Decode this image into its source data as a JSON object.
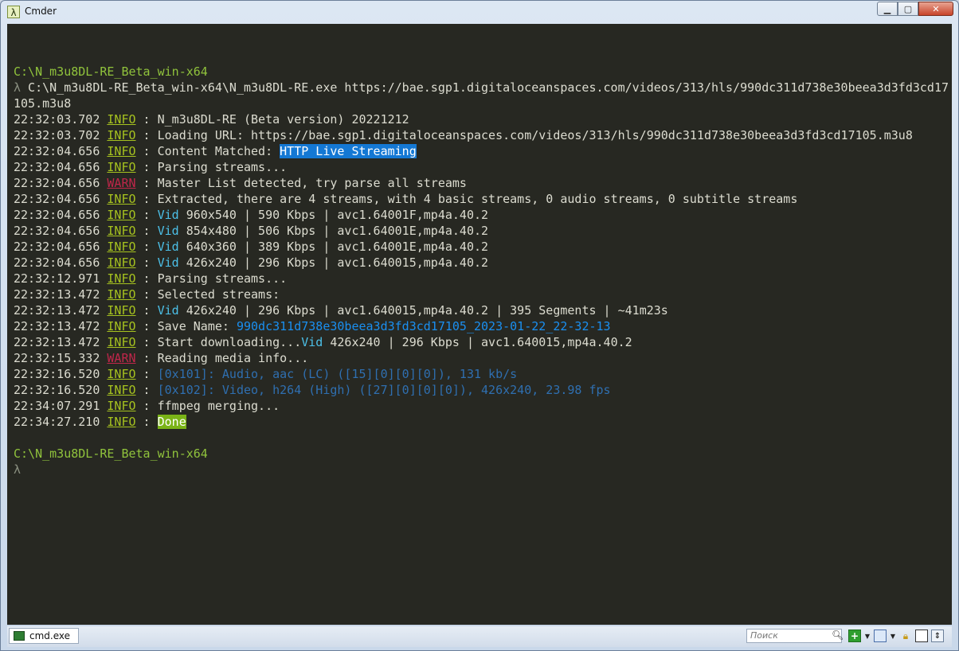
{
  "window": {
    "title": "Cmder",
    "app_icon": "λ",
    "min_glyph": "▁",
    "max_glyph": "▢",
    "close_glyph": "✕"
  },
  "terminal": {
    "prompt_path_1": "C:\\N_m3u8DL-RE_Beta_win-x64",
    "prompt_symbol": "λ",
    "command_line_1": " C:\\N_m3u8DL-RE_Beta_win-x64\\N_m3u8DL-RE.exe https://bae.sgp1.digitaloceanspaces.com/videos/313/hls/990dc311d738e30beea3d3fd3cd17",
    "command_line_2": "105.m3u8",
    "log": [
      {
        "time": "22:32:03.702",
        "level": "INFO",
        "text": "N_m3u8DL-RE (Beta version) 20221212"
      },
      {
        "time": "22:32:03.702",
        "level": "INFO",
        "text": "Loading URL: https://bae.sgp1.digitaloceanspaces.com/videos/313/hls/990dc311d738e30beea3d3fd3cd17105.m3u8"
      },
      {
        "time": "22:32:04.656",
        "level": "INFO",
        "text": "Content Matched: ",
        "highlight": "HTTP Live Streaming"
      },
      {
        "time": "22:32:04.656",
        "level": "INFO",
        "text": "Parsing streams..."
      },
      {
        "time": "22:32:04.656",
        "level": "WARN",
        "text": "Master List detected, try parse all streams"
      },
      {
        "time": "22:32:04.656",
        "level": "INFO",
        "text": "Extracted, there are 4 streams, with 4 basic streams, 0 audio streams, 0 subtitle streams"
      },
      {
        "time": "22:32:04.656",
        "level": "INFO",
        "vid": "Vid",
        "text": " 960x540 | 590 Kbps | avc1.64001F,mp4a.40.2"
      },
      {
        "time": "22:32:04.656",
        "level": "INFO",
        "vid": "Vid",
        "text": " 854x480 | 506 Kbps | avc1.64001E,mp4a.40.2"
      },
      {
        "time": "22:32:04.656",
        "level": "INFO",
        "vid": "Vid",
        "text": " 640x360 | 389 Kbps | avc1.64001E,mp4a.40.2"
      },
      {
        "time": "22:32:04.656",
        "level": "INFO",
        "vid": "Vid",
        "text": " 426x240 | 296 Kbps | avc1.640015,mp4a.40.2"
      },
      {
        "time": "22:32:12.971",
        "level": "INFO",
        "text": "Parsing streams..."
      },
      {
        "time": "22:32:13.472",
        "level": "INFO",
        "text": "Selected streams:"
      },
      {
        "time": "22:32:13.472",
        "level": "INFO",
        "vid": "Vid",
        "text": " 426x240 | 296 Kbps | avc1.640015,mp4a.40.2 | 395 Segments | ~41m23s"
      },
      {
        "time": "22:32:13.472",
        "level": "INFO",
        "text": "Save Name: ",
        "link": "990dc311d738e30beea3d3fd3cd17105_2023-01-22_22-32-13"
      },
      {
        "time": "22:32:13.472",
        "level": "INFO",
        "text": "Start downloading...",
        "vid": "Vid",
        "text2": " 426x240 | 296 Kbps | avc1.640015,mp4a.40.2"
      },
      {
        "time": "22:32:15.332",
        "level": "WARN",
        "text": "Reading media info..."
      },
      {
        "time": "22:32:16.520",
        "level": "INFO",
        "dim": "[0x101]: Audio, aac (LC) ([15][0][0][0]), 131 kb/s"
      },
      {
        "time": "22:32:16.520",
        "level": "INFO",
        "dim": "[0x102]: Video, h264 (High) ([27][0][0][0]), 426x240, 23.98 fps"
      },
      {
        "time": "22:34:07.291",
        "level": "INFO",
        "text": "ffmpeg merging..."
      },
      {
        "time": "22:34:27.210",
        "level": "INFO",
        "done": "Done"
      }
    ],
    "prompt_path_2": "C:\\N_m3u8DL-RE_Beta_win-x64"
  },
  "statusbar": {
    "tab_label": "cmd.exe",
    "search_placeholder": "Поиск",
    "icons": [
      "search-icon",
      "new-console-icon",
      "panel-icon",
      "lock-icon",
      "layout-icon",
      "scroll-icon"
    ]
  }
}
